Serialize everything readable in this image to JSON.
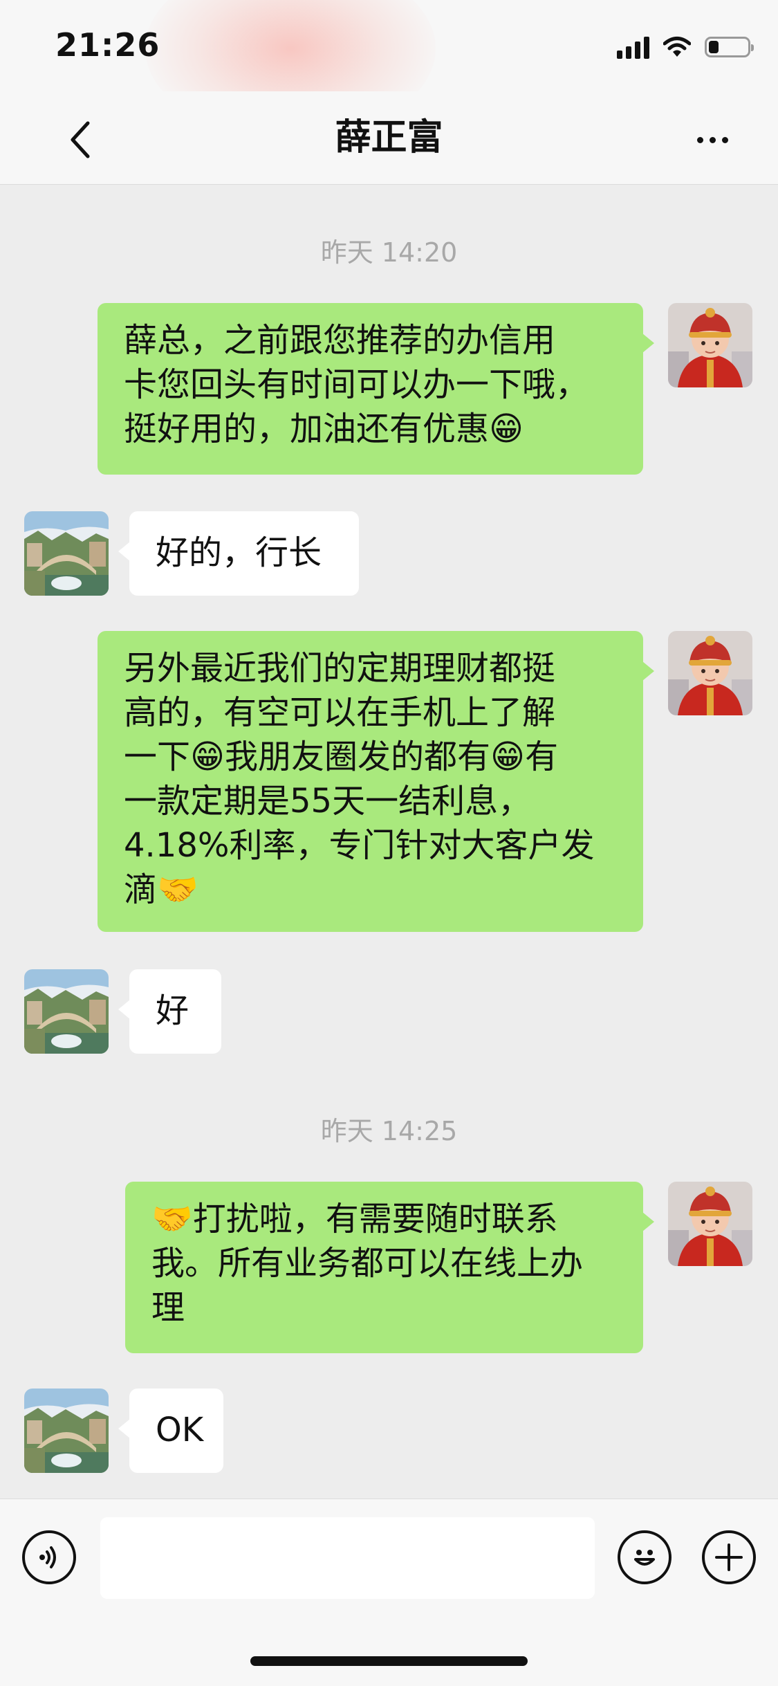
{
  "status_bar": {
    "time": "21:26",
    "battery_fraction": 0.25
  },
  "header": {
    "title": "薛正富"
  },
  "messages": [
    {
      "type": "timestamp",
      "text": "昨天 14:20"
    },
    {
      "type": "message",
      "direction": "outgoing",
      "avatar": "baby-avatar",
      "text": "薛总，之前跟您推荐的办信用\n卡您回头有时间可以办一下哦，\n挺好用的，加油还有优惠😁"
    },
    {
      "type": "message",
      "direction": "incoming",
      "avatar": "bridge-avatar",
      "text": "好的，行长"
    },
    {
      "type": "message",
      "direction": "outgoing",
      "avatar": "baby-avatar",
      "text": "另外最近我们的定期理财都挺\n高的，有空可以在手机上了解\n一下😁我朋友圈发的都有😁有\n一款定期是55天一结利息，\n4.18%利率，专门针对大客户发\n滴🤝"
    },
    {
      "type": "message",
      "direction": "incoming",
      "avatar": "bridge-avatar",
      "text": "好"
    },
    {
      "type": "timestamp",
      "text": "昨天 14:25"
    },
    {
      "type": "message",
      "direction": "outgoing",
      "avatar": "baby-avatar",
      "text": "🤝打扰啦，有需要随时联系\n我。所有业务都可以在线上办\n理"
    },
    {
      "type": "message",
      "direction": "incoming",
      "avatar": "bridge-avatar",
      "text": "OK"
    }
  ],
  "input_bar": {
    "message_value": "",
    "left_icon": "voice-icon",
    "right_icons": [
      "emoji-icon",
      "plus-icon"
    ]
  },
  "colors": {
    "outgoing_bubble": "#a9e97d",
    "incoming_bubble": "#ffffff",
    "chat_background": "#ededed",
    "bar_background": "#f7f7f7",
    "timestamp_text": "#a8a8a8"
  }
}
